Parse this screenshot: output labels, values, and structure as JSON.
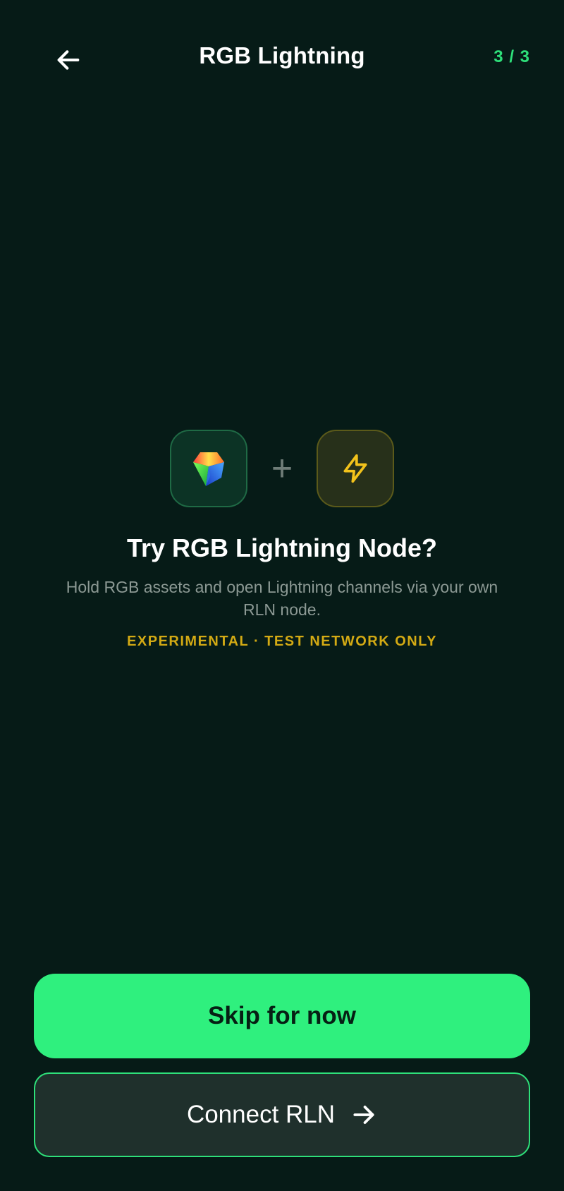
{
  "header": {
    "title": "RGB Lightning",
    "step": "3 / 3",
    "back_icon": "arrow-left-icon"
  },
  "intro": {
    "rgb_icon": "rgb-gem-icon",
    "plus_symbol": "+",
    "bolt_icon": "lightning-bolt-icon",
    "headline": "Try RGB Lightning Node?",
    "description": "Hold RGB assets and open Lightning channels via your own RLN node.",
    "badge": "EXPERIMENTAL · TEST NETWORK ONLY"
  },
  "actions": {
    "skip_label": "Skip for now",
    "connect_label": "Connect RLN",
    "connect_icon": "arrow-right-icon"
  },
  "colors": {
    "background": "#061b17",
    "accent": "#2ff07e",
    "warning": "#d3aa14"
  }
}
